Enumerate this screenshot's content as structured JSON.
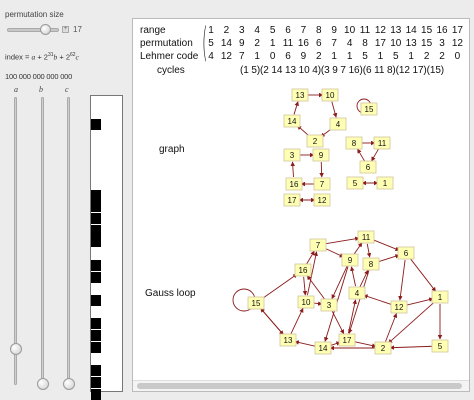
{
  "controls": {
    "perm_size_label": "permutation size",
    "plus": "+",
    "perm_size_value": "17",
    "index_formula": {
      "prefix": "index = ",
      "a": "a",
      "plus1": " + 2",
      "exp1": "31",
      "b": "b",
      "plus2": " + 2",
      "exp2": "62",
      "c": "c"
    },
    "index_value": "100 000 000 000 000",
    "slider_labels": [
      "a",
      "b",
      "c"
    ]
  },
  "bits": [
    2,
    8,
    9,
    10,
    11,
    12,
    14,
    15,
    17,
    19,
    20,
    21,
    23,
    24,
    25
  ],
  "table": {
    "range_label": "range",
    "permutation_label": "permutation",
    "lehmer_label": "Lehmer code",
    "cycles_label": "cycles",
    "range": [
      "1",
      "2",
      "3",
      "4",
      "5",
      "6",
      "7",
      "8",
      "9",
      "10",
      "11",
      "12",
      "13",
      "14",
      "15",
      "16",
      "17"
    ],
    "permutation": [
      "5",
      "14",
      "9",
      "2",
      "1",
      "11",
      "16",
      "6",
      "7",
      "4",
      "8",
      "17",
      "10",
      "13",
      "15",
      "3",
      "12"
    ],
    "lehmer": [
      "4",
      "12",
      "7",
      "1",
      "0",
      "6",
      "9",
      "2",
      "1",
      "1",
      "5",
      "1",
      "5",
      "1",
      "2",
      "2",
      "0"
    ],
    "cycles": "(1 5)(2 14 13 10 4)(3 9 7 16)(6 11 8)(12 17)(15)"
  },
  "graph_label": "graph",
  "gauss_label": "Gauss loop",
  "colors": {
    "node_fill": "#ffffb4",
    "edge": "#8b1b1b"
  }
}
